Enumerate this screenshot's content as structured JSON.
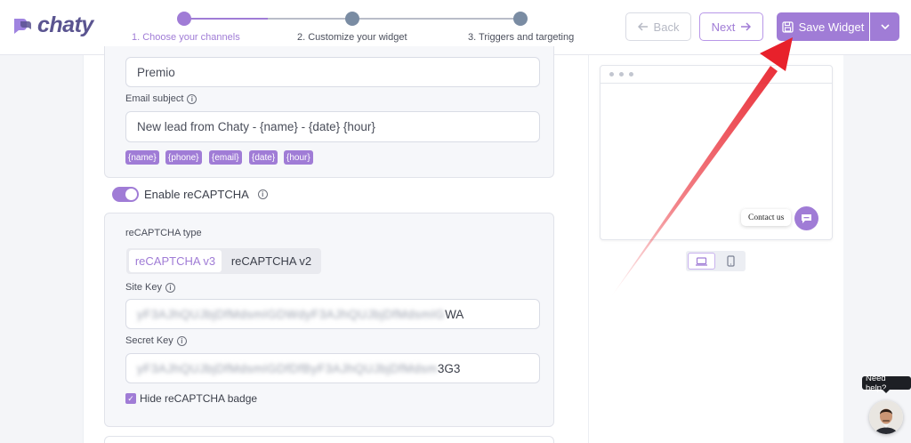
{
  "header": {
    "logo_text": "chaty",
    "steps": [
      {
        "label": "1. Choose your channels",
        "active": true
      },
      {
        "label": "2. Customize your widget",
        "active": false
      },
      {
        "label": "3. Triggers and targeting",
        "active": false
      }
    ],
    "back_label": "Back",
    "next_label": "Next",
    "save_label": "Save Widget"
  },
  "form": {
    "name_value": "Premio",
    "email_subject_label": "Email subject",
    "email_subject_value": "New lead from Chaty - {name} - {date} {hour}",
    "tags": [
      "{name}",
      "{phone}",
      "{email}",
      "{date}",
      "{hour}"
    ],
    "recaptcha_toggle_label": "Enable reCAPTCHA",
    "recaptcha_enabled": true,
    "recaptcha_type_label": "reCAPTCHA type",
    "recaptcha_options": [
      "reCAPTCHA v3",
      "reCAPTCHA v2"
    ],
    "recaptcha_selected": "reCAPTCHA v3",
    "site_key_label": "Site Key",
    "site_key_hidden": "yF3AJhQUJbjDfMdsmIGDWdyF3AJhQUJbjDfMdsmIG",
    "site_key_visible": "WA",
    "secret_key_label": "Secret Key",
    "secret_key_hidden": "yF3AJhQUJbjDfMdsmIGDfDfByF3AJhQUJbjDfMdsm",
    "secret_key_visible": "3G3",
    "hide_badge_label": "Hide reCAPTCHA badge",
    "hide_badge_checked": true
  },
  "preview": {
    "contact_label": "Contact us",
    "device_selected": "desktop"
  },
  "help": {
    "label": "Need help?"
  },
  "colors": {
    "accent": "#a07cd6",
    "arrow": "#e8212b"
  }
}
